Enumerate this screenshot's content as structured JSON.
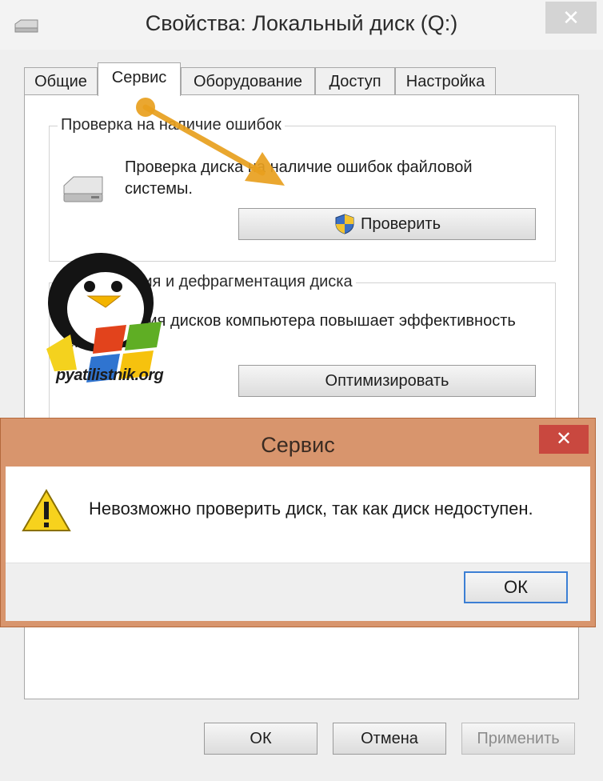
{
  "window": {
    "title": "Свойства: Локальный диск (Q:)",
    "close_glyph": "✕",
    "icon": "drive-icon"
  },
  "tabs": [
    {
      "label": "Общие",
      "active": false
    },
    {
      "label": "Сервис",
      "active": true
    },
    {
      "label": "Оборудование",
      "active": false
    },
    {
      "label": "Доступ",
      "active": false
    },
    {
      "label": "Настройка",
      "active": false
    }
  ],
  "error_check": {
    "group_label": "Проверка на наличие ошибок",
    "description": "Проверка диска на наличие ошибок файловой системы.",
    "button_label": "Проверить"
  },
  "defrag": {
    "group_label": "Оптимизация и дефрагментация диска",
    "description": "Оптимизация дисков компьютера повышает эффективность его работы.",
    "button_label": "Оптимизировать"
  },
  "footer": {
    "ok": "ОК",
    "cancel": "Отмена",
    "apply": "Применить"
  },
  "dialog": {
    "title": "Сервис",
    "message": "Невозможно проверить диск, так как диск недоступен.",
    "ok": "ОК",
    "close_glyph": "✕",
    "icon": "warning-icon"
  },
  "watermark": {
    "text": "pyatilistnik.org"
  },
  "colors": {
    "dialog_frame": "#d8956d",
    "close_red": "#c9483f",
    "focus_blue": "#3c7fd4",
    "arrow": "#e8a01e"
  }
}
